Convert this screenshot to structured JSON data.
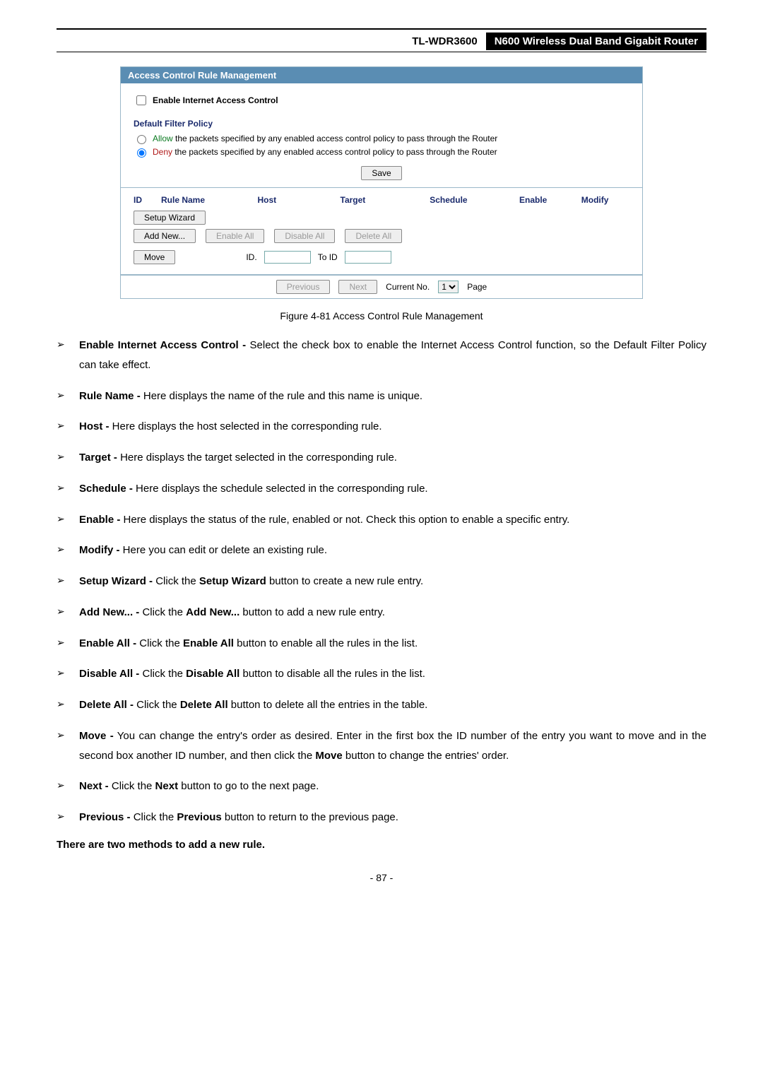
{
  "header": {
    "model": "TL-WDR3600",
    "product": "N600 Wireless Dual Band Gigabit Router"
  },
  "panel": {
    "title": "Access Control Rule Management",
    "enable_label": "Enable Internet Access Control",
    "policy_header": "Default Filter Policy",
    "policy_allow_prefix": "Allow",
    "policy_allow_rest": " the packets specified by any enabled access control policy to pass through the Router",
    "policy_deny_prefix": "Deny",
    "policy_deny_rest": " the packets specified by any enabled access control policy to pass through the Router",
    "save_btn": "Save",
    "cols": {
      "id": "ID",
      "rule": "Rule Name",
      "host": "Host",
      "target": "Target",
      "schedule": "Schedule",
      "enable": "Enable",
      "modify": "Modify"
    },
    "setup_wizard_btn": "Setup Wizard",
    "add_new_btn": "Add New...",
    "enable_all_btn": "Enable All",
    "disable_all_btn": "Disable All",
    "delete_all_btn": "Delete All",
    "move_btn": "Move",
    "id_label": "ID.",
    "to_id_label": "To ID",
    "previous_btn": "Previous",
    "next_btn": "Next",
    "current_no_label": "Current No.",
    "page_label": "Page",
    "page_option": "1"
  },
  "figure_caption": "Figure 4-81 Access Control Rule Management",
  "bullets": [
    {
      "b": "Enable Internet Access Control -",
      "t": " Select the check box to enable the Internet Access Control function, so the Default Filter Policy can take effect."
    },
    {
      "b": "Rule Name -",
      "t": " Here displays the name of the rule and this name is unique."
    },
    {
      "b": "Host -",
      "t": " Here displays the host selected in the corresponding rule."
    },
    {
      "b": "Target -",
      "t": " Here displays the target selected in the corresponding rule."
    },
    {
      "b": "Schedule -",
      "t": " Here displays the schedule selected in the corresponding rule."
    },
    {
      "b": "Enable -",
      "t": " Here displays the status of the rule, enabled or not. Check this option to enable a specific entry."
    },
    {
      "b": "Modify -",
      "t": " Here you can edit or delete an existing rule."
    },
    {
      "b": "Setup Wizard -",
      "t": " Click the ",
      "b2": "Setup Wizard",
      "t2": " button to create a new rule entry."
    },
    {
      "b": "Add New...   -",
      "t": " Click the ",
      "b2": "Add New...",
      "t2": " button to add a new rule entry."
    },
    {
      "b": "Enable All -",
      "t": " Click the ",
      "b2": "Enable All",
      "t2": " button to enable all the rules in the list."
    },
    {
      "b": "Disable All -",
      "t": " Click the ",
      "b2": "Disable All",
      "t2": " button to disable all the rules in the list."
    },
    {
      "b": "Delete All -",
      "t": " Click the ",
      "b2": "Delete All",
      "t2": " button to delete all the entries in the table."
    },
    {
      "b": "Move -",
      "t": " You can change the entry's order as desired. Enter in the first box the ID number of the entry you want to move and in the second box another ID number, and then click the ",
      "b2": "Move",
      "t2": " button to change the entries' order."
    },
    {
      "b": "Next -",
      "t": " Click the ",
      "b2": "Next",
      "t2": " button to go to the next page."
    },
    {
      "b": "Previous -",
      "t": " Click the ",
      "b2": "Previous",
      "t2": " button to return to the previous page."
    }
  ],
  "closing": "There are two methods to add a new rule.",
  "page_number": "- 87 -"
}
